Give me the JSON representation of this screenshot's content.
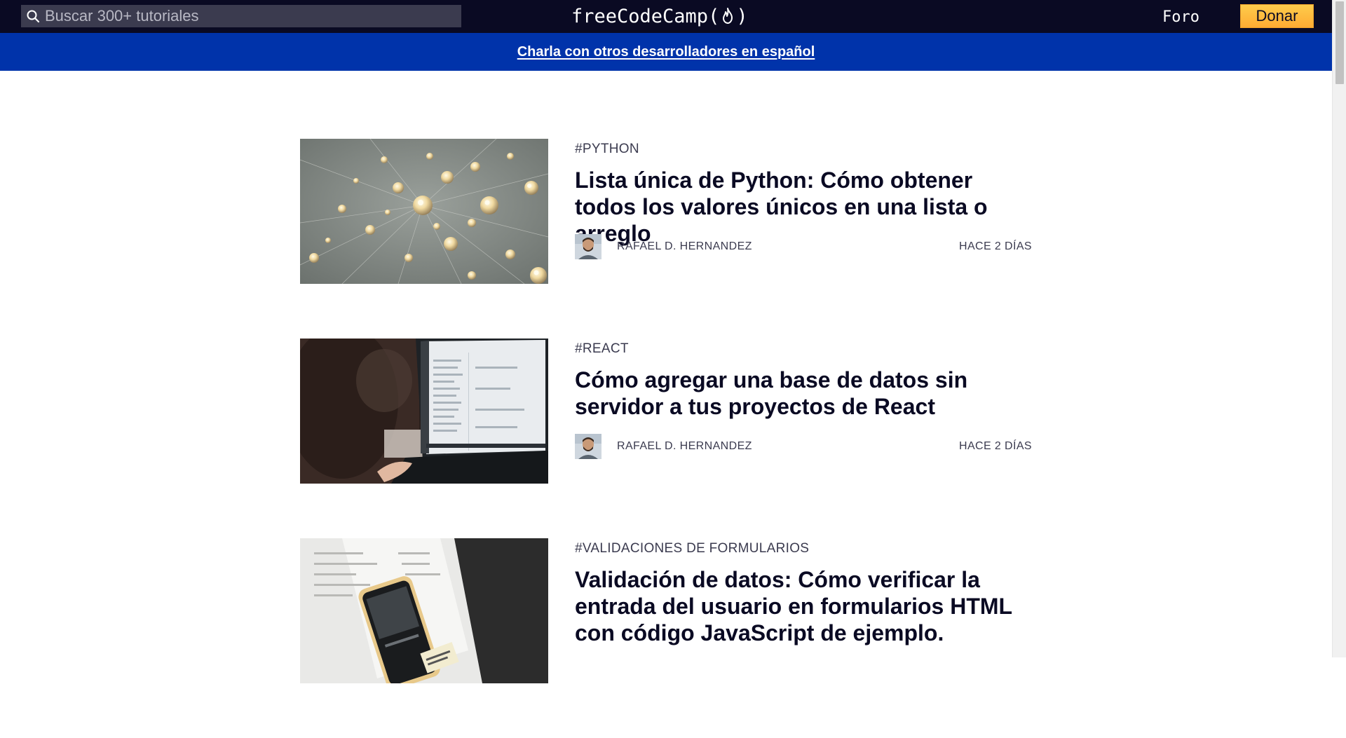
{
  "nav": {
    "search_placeholder": "Buscar 300+ tutoriales",
    "brand_text_left": "freeCodeCamp(",
    "brand_text_right": ")",
    "forum_label": "Foro",
    "donate_label": "Donar"
  },
  "banner": {
    "link_text": "Charla con otros desarrolladores en español"
  },
  "posts": [
    {
      "tag": "#PYTHON",
      "title": "Lista única de Python: Cómo obtener todos los valores únicos en una lista o arreglo",
      "author": "RAFAEL D. HERNANDEZ",
      "date": "HACE 2 DÍAS"
    },
    {
      "tag": "#REACT",
      "title": "Cómo agregar una base de datos sin servidor a tus proyectos de React",
      "author": "RAFAEL D. HERNANDEZ",
      "date": "HACE 2 DÍAS"
    },
    {
      "tag": "#VALIDACIONES DE FORMULARIOS",
      "title": "Validación de datos: Cómo verificar la entrada del usuario en formularios HTML con código JavaScript de ejemplo."
    }
  ],
  "colors": {
    "nav_bg": "#0a0a23",
    "banner_bg": "#0033aa",
    "donate_bg": "#ffbf00",
    "text_dark": "#0a0a23",
    "text_muted": "#3b3b4f"
  },
  "icons": {
    "search": "search-icon",
    "flame": "flame-icon"
  }
}
